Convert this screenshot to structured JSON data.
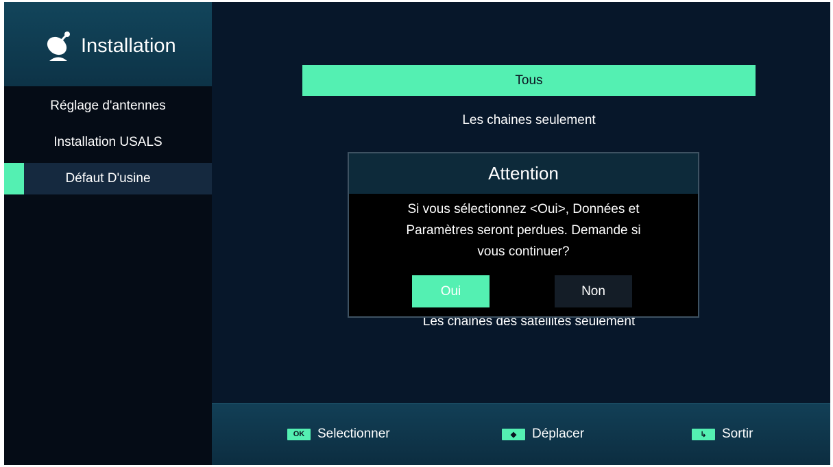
{
  "sidebar": {
    "header": {
      "icon": "satellite-dish-icon",
      "title": "Installation"
    },
    "items": [
      {
        "label": "Réglage d'antennes"
      },
      {
        "label": "Installation USALS"
      },
      {
        "label": "Défaut D'usine",
        "active": true
      }
    ]
  },
  "main": {
    "options": [
      {
        "label": "Tous",
        "selected": true
      },
      {
        "label": "Les chaines seulement"
      },
      {
        "label": "Les chaines des satellites seulement"
      }
    ]
  },
  "dialog": {
    "title": "Attention",
    "message_lines": [
      "Si vous sélectionnez <Oui>, Données et",
      "Paramètres seront perdues. Demande si",
      "vous continuer?"
    ],
    "buttons": {
      "yes": "Oui",
      "no": "Non"
    }
  },
  "footer": {
    "hints": [
      {
        "key": "OK",
        "icon": "ok-key-icon",
        "label": "Selectionner"
      },
      {
        "key": "◆",
        "icon": "up-down-arrow-icon",
        "label": "Déplacer"
      },
      {
        "key": "↳",
        "icon": "exit-arrow-icon",
        "label": "Sortir"
      }
    ]
  },
  "colors": {
    "accent": "#54f0b2",
    "background": "#07172a",
    "sidebar": "#050c16",
    "header": "#0d3347"
  }
}
